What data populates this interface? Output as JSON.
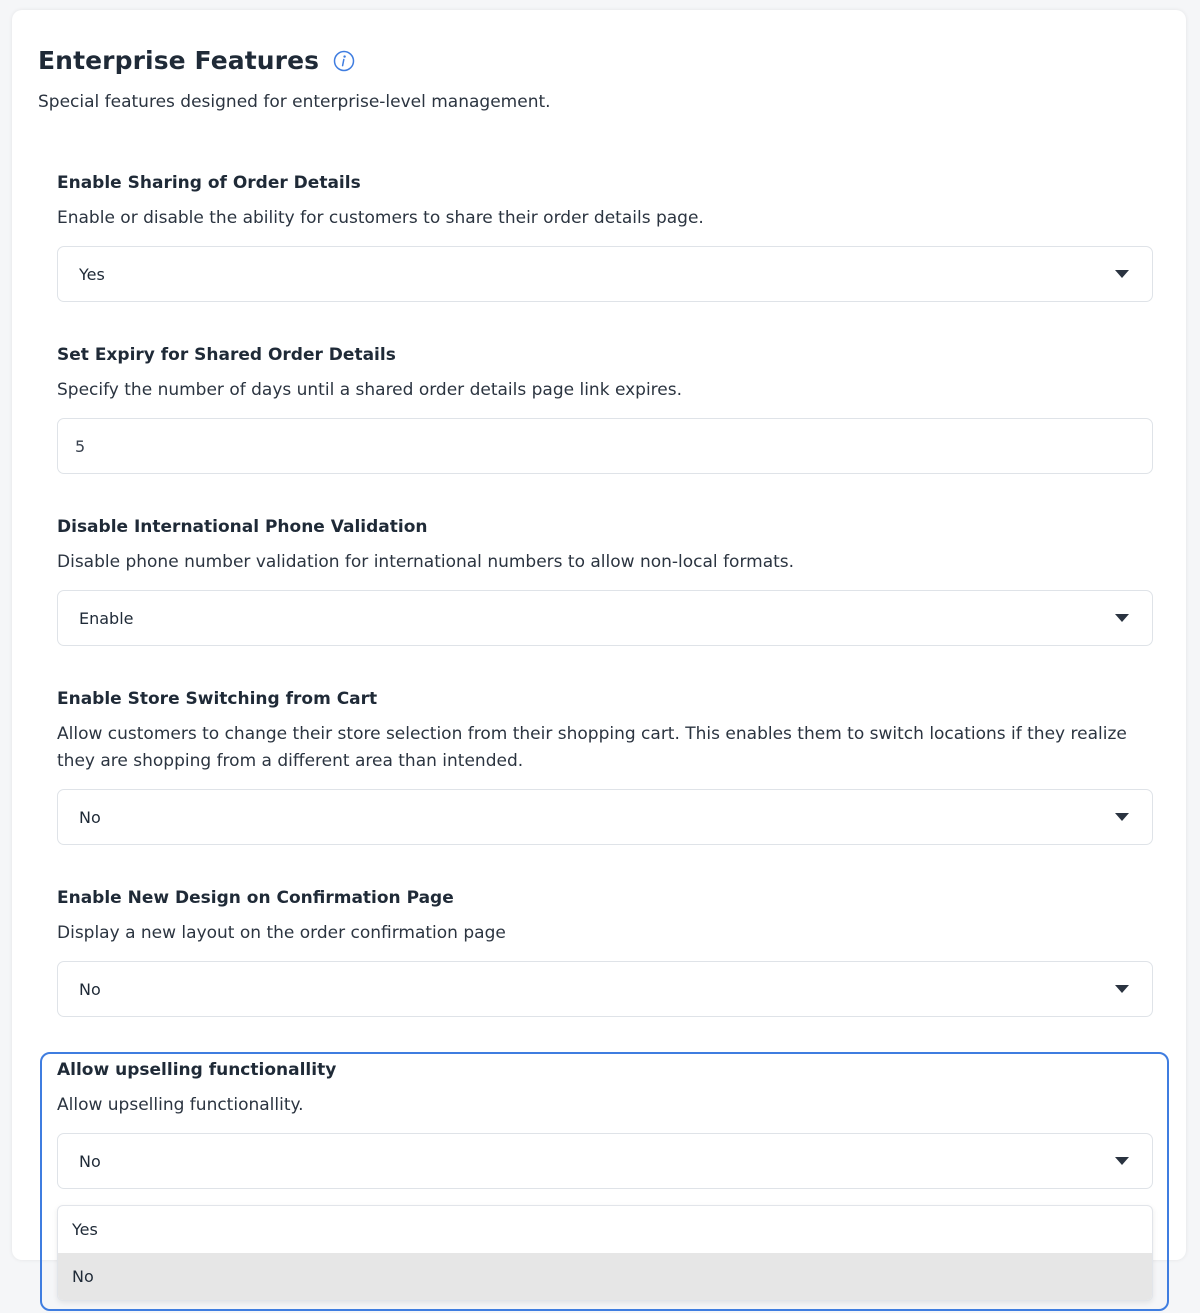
{
  "section": {
    "title": "Enterprise Features",
    "subtitle": "Special features designed for enterprise-level management.",
    "info_icon": "info-icon"
  },
  "settings": [
    {
      "title": "Enable Sharing of Order Details",
      "description": "Enable or disable the ability for customers to share their order details page.",
      "type": "select",
      "value": "Yes"
    },
    {
      "title": "Set Expiry for Shared Order Details",
      "description": "Specify the number of days until a shared order details page link expires.",
      "type": "input",
      "value": "5"
    },
    {
      "title": "Disable International Phone Validation",
      "description": "Disable phone number validation for international numbers to allow non-local formats.",
      "type": "select",
      "value": "Enable"
    },
    {
      "title": "Enable Store Switching from Cart",
      "description": "Allow customers to change their store selection from their shopping cart. This enables them to switch locations if they realize they are shopping from a different area than intended.",
      "type": "select",
      "value": "No"
    },
    {
      "title": "Enable New Design on Confirmation Page",
      "description": "Display a new layout on the order confirmation page",
      "type": "select",
      "value": "No"
    },
    {
      "title": "Allow upselling functionallity",
      "description": "Allow upselling functionallity.",
      "type": "select",
      "value": "No",
      "open": true,
      "options": [
        "Yes",
        "No"
      ],
      "highlighted_option": "No"
    }
  ],
  "colors": {
    "accent": "#3f7de0",
    "text": "#1f2a37",
    "border": "#dfe3e8",
    "option_hover": "#e6e6e6"
  }
}
